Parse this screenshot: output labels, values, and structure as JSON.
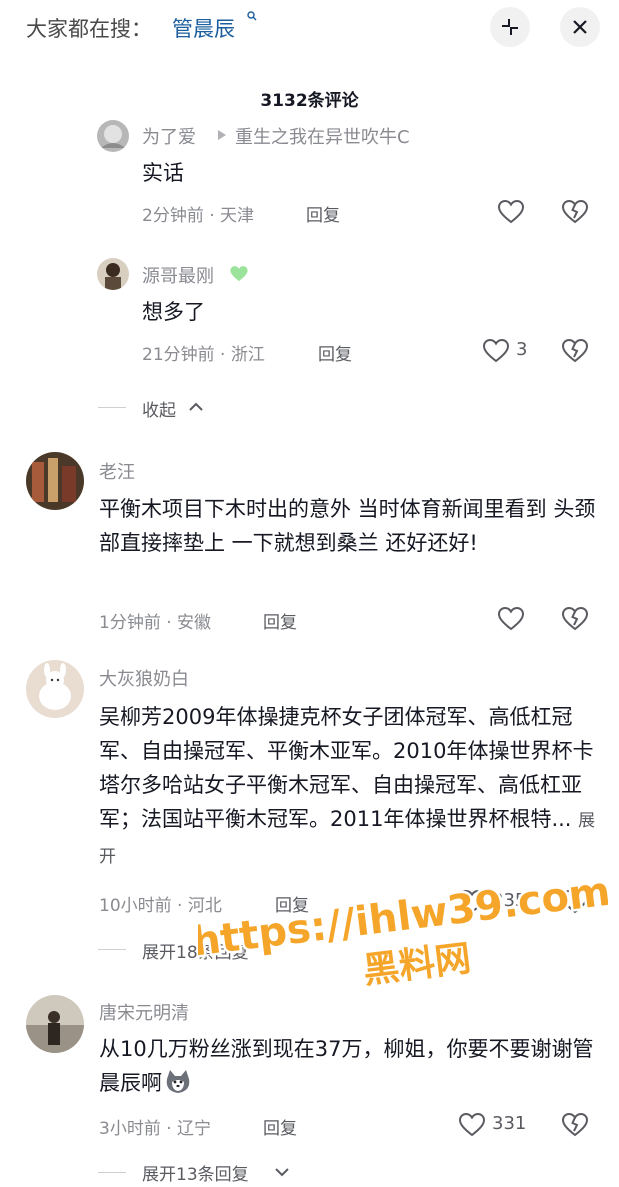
{
  "search": {
    "prefix": "大家都在搜：",
    "term": "管晨辰"
  },
  "comments_title": "3132条评论",
  "comments": [
    {
      "username": "为了爱",
      "reply_to": "重生之我在异世吹牛C",
      "text": "实话",
      "time_location": "2分钟前 · 天津",
      "reply_label": "回复",
      "likes": ""
    },
    {
      "username": "源哥最刚",
      "text": "想多了",
      "time_location": "21分钟前 · 浙江",
      "reply_label": "回复",
      "likes": "3"
    },
    {
      "username": "老汪",
      "text": "平衡木项目下木时出的意外  当时体育新闻里看到 头颈部直接摔垫上  一下就想到桑兰   还好还好!",
      "time_location": "1分钟前 · 安徽",
      "reply_label": "回复",
      "likes": ""
    },
    {
      "username": "大灰狼奶白",
      "text": "吴柳芳2009年体操捷克杯女子团体冠军、高低杠冠军、自由操冠军、平衡木亚军。2010年体操世界杯卡塔尔多哈站女子平衡木冠军、自由操冠军、高低杠亚军；法国站平衡木冠军。2011年体操世界杯根特...",
      "expand_inline": "展开",
      "time_location": "10小时前 · 河北",
      "reply_label": "回复",
      "likes": "335",
      "expand_replies": "展开18条回复"
    },
    {
      "username": "唐宋元明清",
      "text": "从10几万粉丝涨到现在37万，柳姐，你要不要谢谢管晨辰啊",
      "time_location": "3小时前 · 辽宁",
      "reply_label": "回复",
      "likes": "331",
      "expand_replies": "展开13条回复"
    }
  ],
  "collapse_label": "收起",
  "watermark": {
    "line1": "https://ihlw39.com",
    "line2": "黑料网"
  },
  "colors": {
    "link_blue": "#1d5f9e",
    "gray_text": "#8a8b91",
    "watermark_orange": "#f5a62a",
    "green_heart": "#9be39b"
  }
}
